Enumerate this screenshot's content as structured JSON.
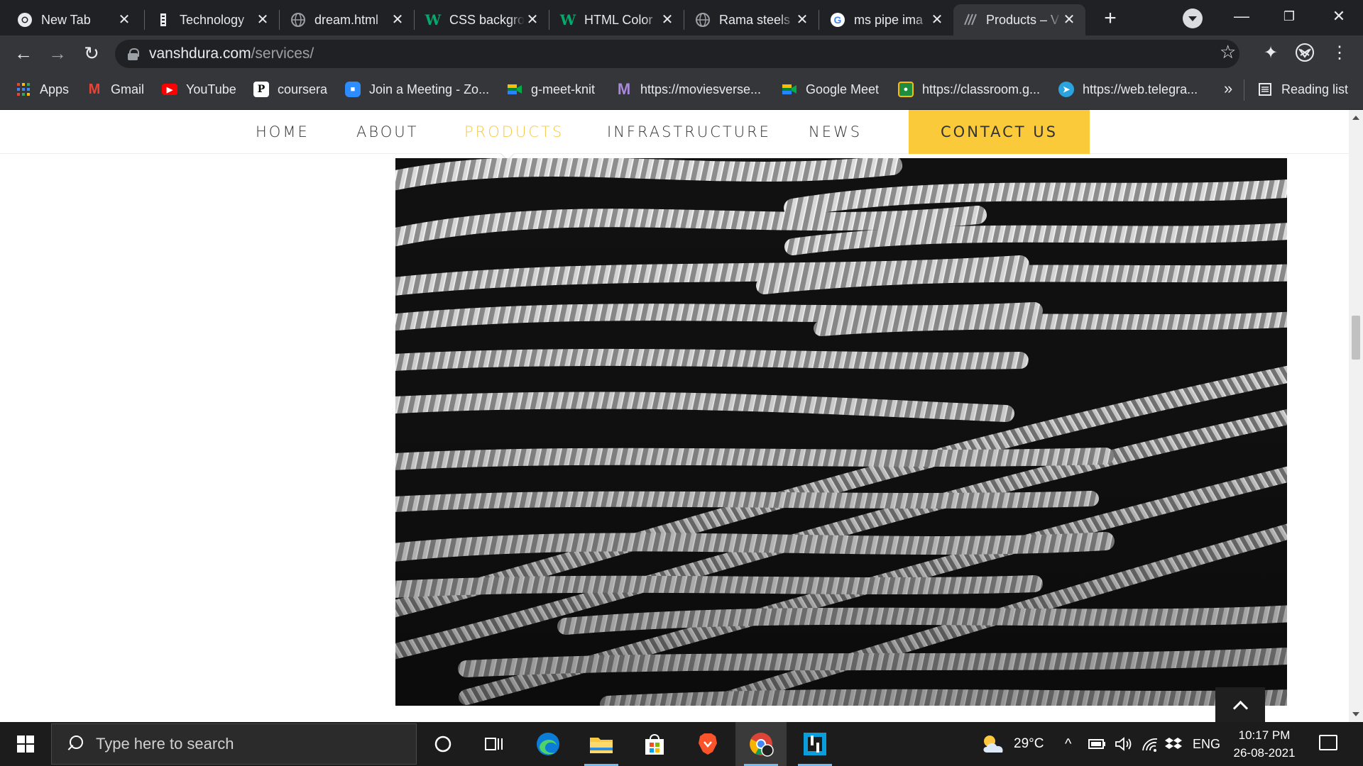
{
  "browser": {
    "tabs": [
      {
        "title": "New Tab",
        "icon": "chrome-icon"
      },
      {
        "title": "Technology",
        "icon": "technology-site-icon"
      },
      {
        "title": "dream.html",
        "icon": "globe-icon"
      },
      {
        "title": "CSS backgro",
        "icon": "w3schools-icon"
      },
      {
        "title": "HTML Color",
        "icon": "w3schools-icon"
      },
      {
        "title": "Rama steels",
        "icon": "globe-icon"
      },
      {
        "title": "ms pipe ima",
        "icon": "google-icon"
      },
      {
        "title": "Products – V",
        "icon": "vanshdura-icon",
        "active": true
      }
    ],
    "url_host": "vanshdura.com",
    "url_path": "/services/",
    "bookmarks": [
      {
        "label": "Apps",
        "icon": "apps-grid-icon"
      },
      {
        "label": "Gmail",
        "icon": "gmail-icon"
      },
      {
        "label": "YouTube",
        "icon": "youtube-icon"
      },
      {
        "label": "coursera",
        "icon": "coursera-icon"
      },
      {
        "label": "Join a Meeting - Zo...",
        "icon": "zoom-icon"
      },
      {
        "label": "g-meet-knit",
        "icon": "google-meet-icon"
      },
      {
        "label": "https://moviesverse...",
        "icon": "moviesverse-icon"
      },
      {
        "label": "Google Meet",
        "icon": "google-meet-icon"
      },
      {
        "label": "https://classroom.g...",
        "icon": "google-classroom-icon"
      },
      {
        "label": "https://web.telegra...",
        "icon": "telegram-icon"
      }
    ],
    "more_bookmarks": "»",
    "reading_list": "Reading list"
  },
  "site": {
    "nav": [
      {
        "label": "HOME"
      },
      {
        "label": "ABOUT"
      },
      {
        "label": "PRODUCTS",
        "active": true
      },
      {
        "label": "INFRASTRUCTURE"
      },
      {
        "label": "NEWS"
      }
    ],
    "cta_label": "CONTACT US",
    "accent_color": "#f2c94c",
    "cta_color": "#fbca3a",
    "hero_image": "steel-rebar-photo"
  },
  "taskbar": {
    "search_placeholder": "Type here to search",
    "weather": "29°C",
    "language": "ENG",
    "time": "10:17 PM",
    "date": "26-08-2021"
  }
}
